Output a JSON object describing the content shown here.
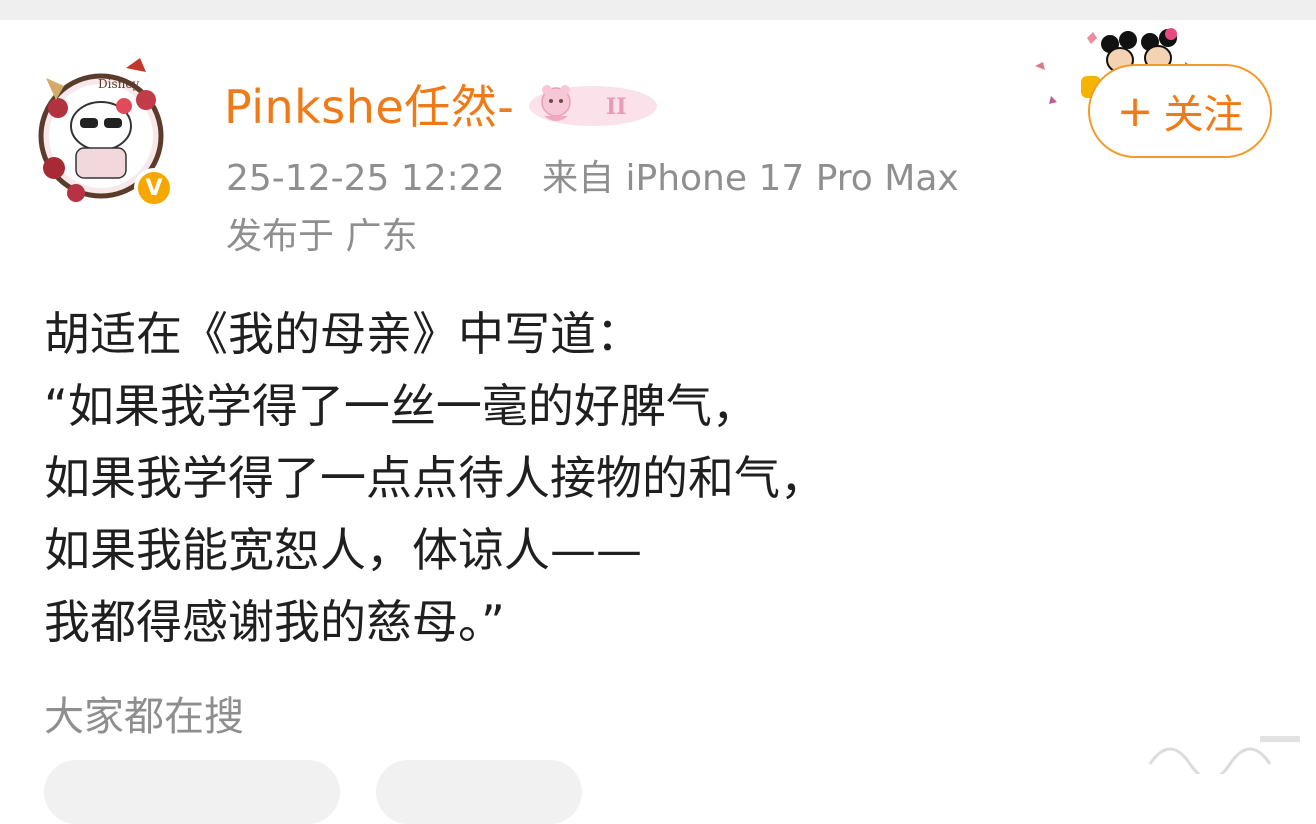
{
  "post": {
    "author": {
      "name": "Pinkshe任然-",
      "avatar_icon": "hello-kitty-avatar-icon",
      "verified_icon": "verified-v-icon",
      "verified_label": "V",
      "level_badge_icon": "pink-bear-badge-icon"
    },
    "time": "25-12-25 12:22",
    "source": "来自 iPhone 17 Pro Max",
    "location": "发布于 广东",
    "follow": {
      "plus": "+",
      "label": "关注",
      "decoration_icon": "mickey-minnie-sticker-icon"
    },
    "content_lines": [
      "胡适在《我的母亲》中写道：",
      "“如果我学得了一丝一毫的好脾气，",
      "如果我学得了一点点待人接物的和气，",
      "如果我能宽恕人，体谅人——",
      "我都得感谢我的慈母。”"
    ]
  },
  "search_section": {
    "title": "大家都在搜"
  },
  "colors": {
    "accent": "#f07a17",
    "follow_border": "#f59a2a",
    "meta": "#8f8f8f",
    "text": "#1f1f1f"
  }
}
